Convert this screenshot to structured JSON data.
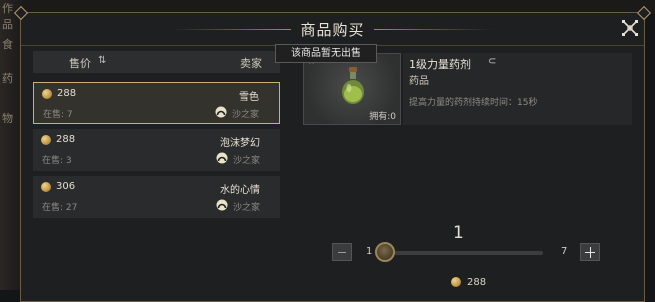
{
  "background": {
    "left_labels": [
      "作品",
      "食",
      "药",
      "物"
    ]
  },
  "window": {
    "title": "商品购买"
  },
  "list": {
    "header_price": "售价",
    "header_seller": "卖家",
    "rows": [
      {
        "price": "288",
        "name": "雪色",
        "stock": "在售: 7",
        "seller": "沙之家",
        "selected": true
      },
      {
        "price": "288",
        "name": "泡沫梦幻",
        "stock": "在售: 3",
        "seller": "沙之家",
        "selected": false
      },
      {
        "price": "306",
        "name": "水的心情",
        "stock": "在售: 27",
        "seller": "沙之家",
        "selected": false
      }
    ]
  },
  "tooltip": "该商品暂无出售",
  "item": {
    "name": "1级力量药剂",
    "type": "药品",
    "description": "提高力量的药剂持续时间：15秒",
    "owned": "拥有:0"
  },
  "quantity": {
    "value": "1",
    "min": "1",
    "max": "7",
    "fraction": 0
  },
  "total": {
    "price": "288"
  },
  "colors": {
    "accent_gold": "#c9b27a",
    "panel": "#2a2b2c"
  }
}
